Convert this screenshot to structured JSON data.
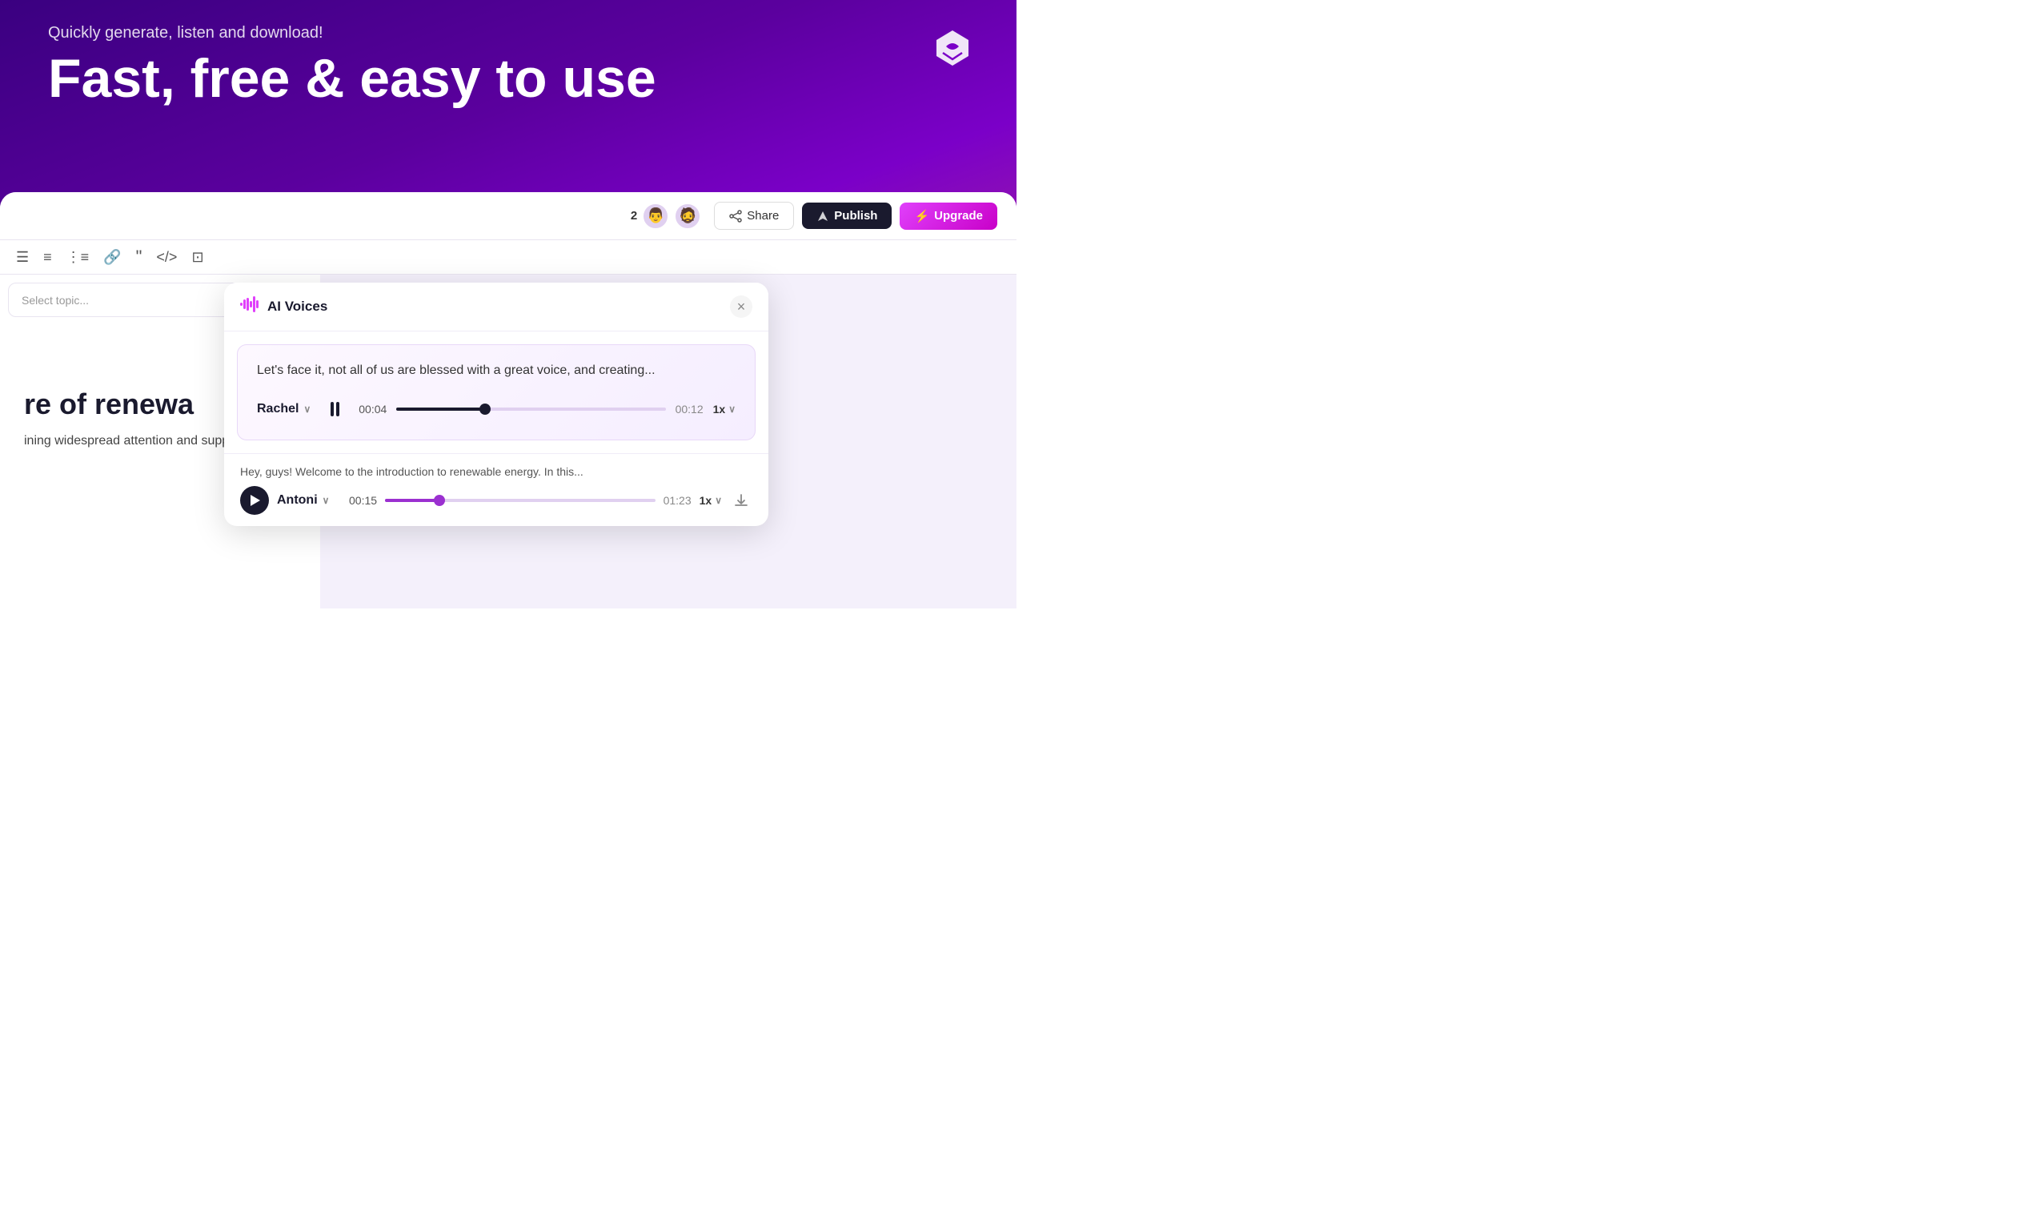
{
  "hero": {
    "subtitle": "Quickly generate, listen and download!",
    "title": "Fast, free & easy to use"
  },
  "toolbar": {
    "collab_count": "2",
    "share_label": "Share",
    "publish_label": "Publish",
    "upgrade_label": "Upgrade",
    "avatar1_emoji": "👨",
    "avatar2_emoji": "🧔"
  },
  "editor_toolbar": {
    "icons": [
      "≡",
      "≡",
      "≡",
      "🔗",
      "❝❝",
      "</>",
      "🖼"
    ]
  },
  "editor": {
    "heading": "re of renewa",
    "body": "ining widespread attention and support"
  },
  "topic_selector": {
    "placeholder": "",
    "chevron": "∨"
  },
  "ai_voices": {
    "title": "AI Voices",
    "close": "×",
    "player": {
      "text": "Let's face it, not all of us are blessed with a great voice, and creating...",
      "voice_name": "Rachel",
      "time_current": "00:04",
      "time_total": "00:12",
      "speed": "1x",
      "progress_pct": 33
    },
    "second_item": {
      "text": "Hey, guys! Welcome to the introduction to renewable energy. In this...",
      "voice_name": "Antoni",
      "time_current": "00:15",
      "time_total": "01:23",
      "speed": "1x",
      "progress_pct": 20
    }
  },
  "download_fab": {
    "label": "Download"
  },
  "colors": {
    "bg_dark": "#3a0080",
    "bg_mid": "#7b00c8",
    "accent_pink": "#e040fb",
    "accent_purple": "#9b30d0",
    "btn_publish_bg": "#1a1a2e"
  }
}
